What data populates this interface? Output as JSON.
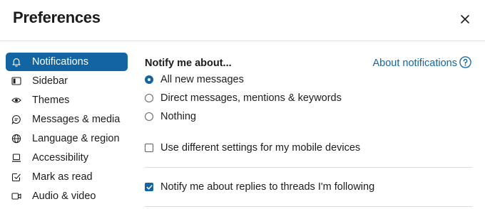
{
  "header": {
    "title": "Preferences",
    "close_icon": "close-icon"
  },
  "sidebar": {
    "items": [
      {
        "label": "Notifications",
        "icon": "bell-icon",
        "active": true
      },
      {
        "label": "Sidebar",
        "icon": "sidebar-icon",
        "active": false
      },
      {
        "label": "Themes",
        "icon": "eye-icon",
        "active": false
      },
      {
        "label": "Messages & media",
        "icon": "message-icon",
        "active": false
      },
      {
        "label": "Language & region",
        "icon": "globe-icon",
        "active": false
      },
      {
        "label": "Accessibility",
        "icon": "laptop-icon",
        "active": false
      },
      {
        "label": "Mark as read",
        "icon": "check-square-icon",
        "active": false
      },
      {
        "label": "Audio & video",
        "icon": "video-icon",
        "active": false
      }
    ]
  },
  "main": {
    "section_title": "Notify me about...",
    "about_link": "About notifications",
    "help_icon": "question-circle-icon",
    "notify_options": [
      {
        "label": "All new messages",
        "selected": true
      },
      {
        "label": "Direct messages, mentions & keywords",
        "selected": false
      },
      {
        "label": "Nothing",
        "selected": false
      }
    ],
    "mobile_settings": {
      "label": "Use different settings for my mobile devices",
      "checked": false
    },
    "thread_replies": {
      "label": "Notify me about replies to threads I'm following",
      "checked": true
    }
  },
  "colors": {
    "accent": "#1264a3",
    "text": "#1d1c1d",
    "divider": "#dcdcdc"
  }
}
